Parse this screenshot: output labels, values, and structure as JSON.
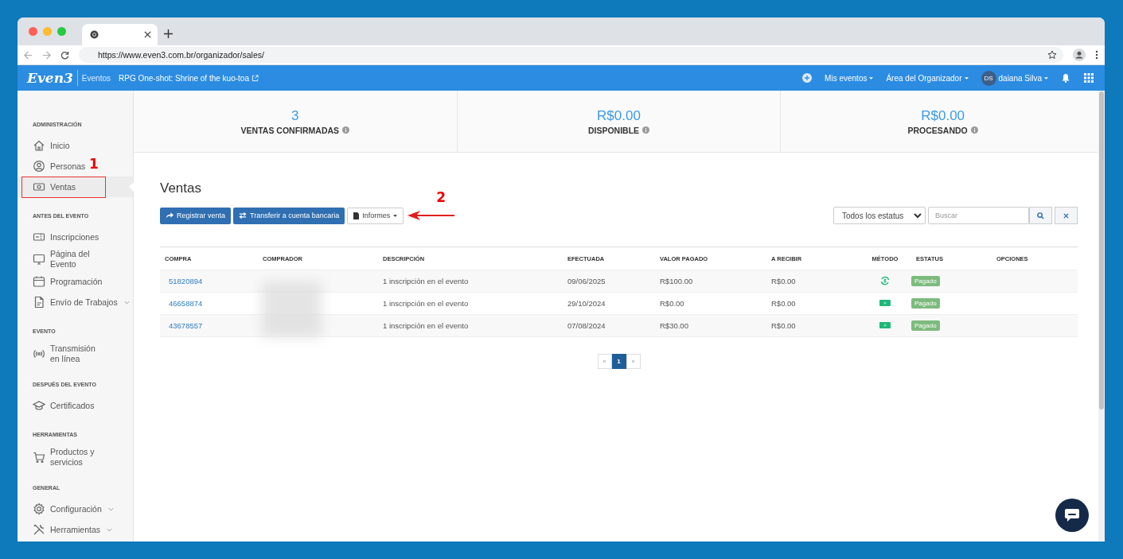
{
  "browser": {
    "url": "https://www.even3.com.br/organizador/sales/"
  },
  "header": {
    "logo": "Even3",
    "section": "Eventos",
    "event_title": "RPG One-shot: Shrine of the kuo-toa",
    "nav": [
      {
        "label": "Mis eventos"
      },
      {
        "label": "Área del Organizador"
      }
    ],
    "user": {
      "initials": "DS",
      "name": "daiana Silva"
    }
  },
  "sidebar": {
    "sections": [
      {
        "heading": "ADMINISTRACIÓN",
        "items": [
          {
            "label": "Inicio",
            "selected": false,
            "submenu": false
          },
          {
            "label": "Personas",
            "selected": false,
            "submenu": false
          },
          {
            "label": "Ventas",
            "selected": true,
            "submenu": false
          }
        ]
      },
      {
        "heading": "ANTES DEL EVENTO",
        "items": [
          {
            "label": "Inscripciones",
            "selected": false,
            "submenu": false
          },
          {
            "label": "Página del Evento",
            "selected": false,
            "submenu": false
          },
          {
            "label": "Programación",
            "selected": false,
            "submenu": false
          },
          {
            "label": "Envío de Trabajos",
            "selected": false,
            "submenu": true
          }
        ]
      },
      {
        "heading": "EVENTO",
        "items": [
          {
            "label": "Transmisión en línea",
            "selected": false,
            "submenu": false
          }
        ]
      },
      {
        "heading": "DESPUÉS DEL EVENTO",
        "items": [
          {
            "label": "Certificados",
            "selected": false,
            "submenu": false
          }
        ]
      },
      {
        "heading": "HERRAMIENTAS",
        "items": [
          {
            "label": "Productos y servicios",
            "selected": false,
            "submenu": false
          }
        ]
      },
      {
        "heading": "GENERAL",
        "items": [
          {
            "label": "Configuración",
            "selected": false,
            "submenu": true
          },
          {
            "label": "Herramientas",
            "selected": false,
            "submenu": true
          }
        ]
      }
    ]
  },
  "stats": [
    {
      "value": "3",
      "label": "VENTAS CONFIRMADAS"
    },
    {
      "value": "R$0.00",
      "label": "DISPONIBLE"
    },
    {
      "value": "R$0.00",
      "label": "PROCESANDO"
    }
  ],
  "sales": {
    "title": "Ventas",
    "buttons": [
      {
        "label": "Registrar venta",
        "kind": "primary"
      },
      {
        "label": "Transferir a cuenta bancaria",
        "kind": "primary"
      },
      {
        "label": "Informes",
        "kind": "dropdown"
      }
    ],
    "filter": {
      "status": "Todos los estatus",
      "search_placeholder": "Buscar"
    },
    "table": {
      "columns": [
        "COMPRA",
        "COMPRADOR",
        "DESCRIPCIÓN",
        "EFECTUADA",
        "VALOR PAGADO",
        "A RECIBIR",
        "MÉTODO",
        "ESTATUS",
        "OPCIONES"
      ],
      "rows": [
        {
          "compra": "51820894",
          "descripcion": "1 inscripción en el evento",
          "efectuada": "09/06/2025",
          "valor_pagado": "R$100.00",
          "a_recibir": "R$0.00",
          "metodo": {
            "kind": "transfer"
          },
          "estatus": "Pagado"
        },
        {
          "compra": "46658874",
          "descripcion": "1 inscripción en el evento",
          "efectuada": "29/10/2024",
          "valor_pagado": "R$0.00",
          "a_recibir": "R$0.00",
          "metodo": {
            "kind": "cash"
          },
          "estatus": "Pagado"
        },
        {
          "compra": "43678557",
          "descripcion": "1 inscripción en el evento",
          "efectuada": "07/08/2024",
          "valor_pagado": "R$30.00",
          "a_recibir": "R$0.00",
          "metodo": {
            "kind": "cash"
          },
          "estatus": "Pagado"
        }
      ]
    },
    "pagination": {
      "prev": "«",
      "pages": [
        {
          "label": "1",
          "selected": true
        }
      ],
      "next": "»"
    }
  },
  "annotations": [
    {
      "label": "1"
    },
    {
      "label": "2"
    }
  ]
}
